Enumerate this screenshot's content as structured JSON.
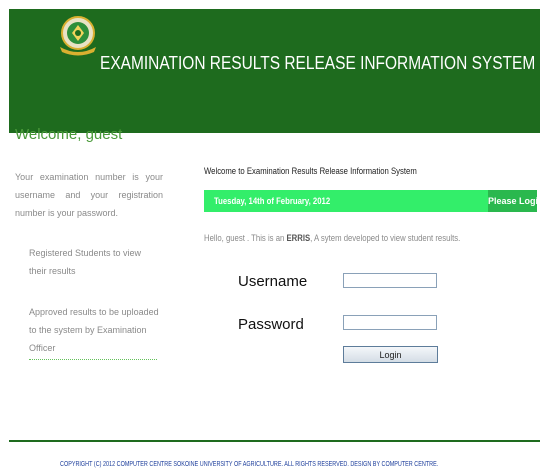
{
  "header": {
    "title": "EXAMINATION RESULTS RELEASE INFORMATION SYSTEM",
    "logo_icon": "university-crest-icon",
    "background": "#1e6b1e"
  },
  "sidebar": {
    "welcome": "Welcome, guest",
    "intro": "Your examination number is your username and your registration number is your password.",
    "items": [
      "Registered Students to view their results",
      "Approved results to be uploaded to the system by Examination Officer"
    ]
  },
  "main": {
    "welcome_message": "Welcome to Examination Results Release Information System",
    "date": "Tuesday, 14th of February, 2012",
    "please_login": "Please Login",
    "hello_prefix": "Hello, guest . This is an",
    "hello_acronym": "ERRIS",
    "hello_suffix": ", A sytem developed to view student results.",
    "date_bar_color": "#33ee6a"
  },
  "login": {
    "username_label": "Username",
    "password_label": "Password",
    "username_value": "",
    "password_value": "",
    "button_label": "Login"
  },
  "footer": {
    "copyright": "COPYRIGHT (C) 2012 COMPUTER CENTRE SOKOINE UNIVERSITY OF AGRICULTURE. ALL RIGHTS RESERVED. DESIGN BY COMPUTER CENTRE."
  }
}
